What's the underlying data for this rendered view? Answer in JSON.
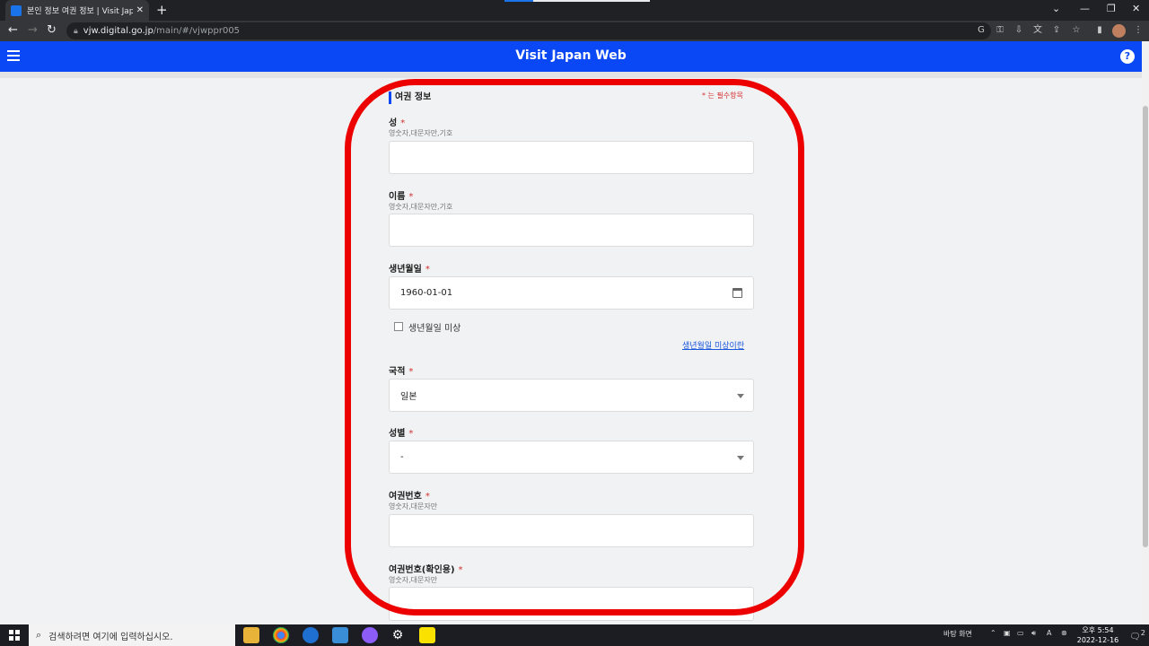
{
  "browser": {
    "tab_title": "본인 정보 여권 정보 | Visit Japan",
    "tab_close": "✕",
    "new_tab": "+",
    "url_host": "vjw.digital.go.jp",
    "url_path": "/main/#/vjwppr005",
    "win_min": "—",
    "win_restore": "❐",
    "win_close": "✕",
    "win_tabsearch": "⌄"
  },
  "app": {
    "title": "Visit Japan Web",
    "help": "?"
  },
  "form": {
    "section_title": "여권 정보",
    "required_note": "* 는 필수항목",
    "asterisk": "*",
    "surname_label": "성",
    "surname_hint": "영숫자,대문자만,기호",
    "surname_value": "",
    "given_label": "이름",
    "given_hint": "영숫자,대문자만,기호",
    "given_value": "",
    "dob_label": "생년월일",
    "dob_value": "1960-01-01",
    "dob_unknown_label": "생년월일 미상",
    "dob_unknown_checked": false,
    "dob_unknown_link": "생년월일 미상이란",
    "nationality_label": "국적",
    "nationality_value": "일본",
    "gender_label": "성별",
    "gender_value": "-",
    "passport_label": "여권번호",
    "passport_hint": "영숫자,대문자만",
    "passport_value": "",
    "passport_confirm_label": "여권번호(확인용)",
    "passport_confirm_hint": "영숫자,대문자만",
    "passport_confirm_value": ""
  },
  "taskbar": {
    "search_placeholder": "검색하려면 여기에 입력하십시오.",
    "desktop_label": "바탕 화면",
    "clock_time": "오후 5:54",
    "clock_date": "2022-12-16",
    "notif_count": "2"
  },
  "colors": {
    "app_bar": "#0a47f5",
    "required": "#d32f2f",
    "annotation": "#ec0000"
  }
}
